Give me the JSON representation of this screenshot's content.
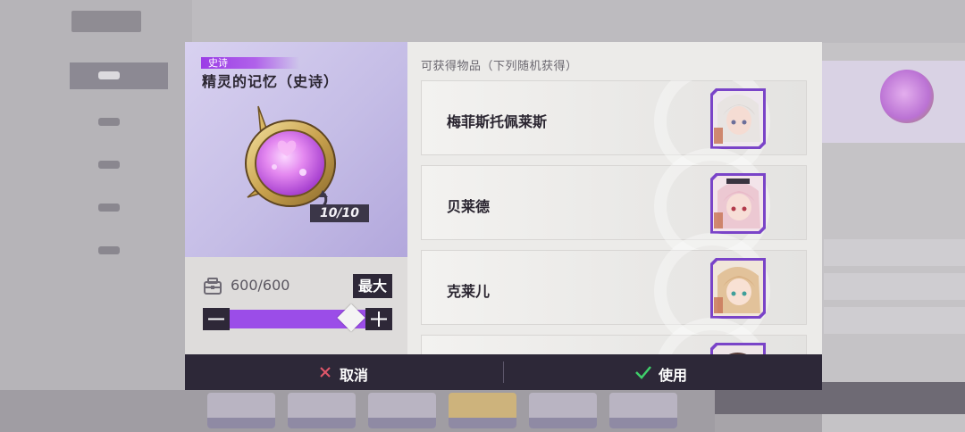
{
  "dialog": {
    "item": {
      "rarity_tag": "史诗",
      "name": "精灵的记忆（史诗）",
      "count": "10/10",
      "icon": "pink-orb-icon"
    },
    "stock": "600/600",
    "max_label": "最大",
    "quantity_fraction": 1.0,
    "rewards_title": "可获得物品（下列随机获得）",
    "rewards": [
      {
        "name": "梅菲斯托佩莱斯",
        "portrait": "white-hair-character-portrait"
      },
      {
        "name": "贝莱德",
        "portrait": "pink-hair-character-portrait"
      },
      {
        "name": "克莱儿",
        "portrait": "blonde-hair-character-portrait"
      }
    ],
    "cancel_label": "取消",
    "use_label": "使用"
  },
  "colors": {
    "accent_purple": "#9b4de8",
    "dark_panel": "#2e2838",
    "cancel_x": "#e0576a",
    "use_check": "#3fcf6a"
  }
}
